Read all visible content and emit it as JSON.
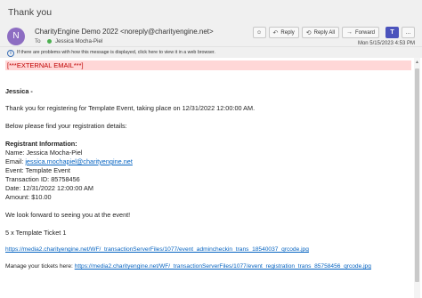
{
  "window": {
    "title": "Thank you"
  },
  "header": {
    "avatar_initial": "N",
    "sender": "CharityEngine Demo 2022 <noreply@charityengine.net>",
    "to_label": "To",
    "recipient": "Jessica Mocha-Piel",
    "datetime": "Mon 5/15/2023 4:53 PM",
    "info_message": "If there are problems with how this message is displayed, click here to view it in a web browser."
  },
  "toolbar": {
    "emoji_icon": "smiley-icon",
    "reply_label": "Reply",
    "reply_all_label": "Reply All",
    "forward_label": "Forward",
    "teams_label": "T",
    "more_label": "..."
  },
  "email": {
    "external_banner": "[***EXTERNAL EMAIL***]",
    "greeting": "Jessica -",
    "intro": "Thank you for registering for Template Event, taking place on 12/31/2022 12:00:00 AM.",
    "details_intro": "Below please find your registration details:",
    "registrant_heading": "Registrant Information:",
    "name_line": "Name: Jessica Mocha-Piel",
    "email_label": "Email: ",
    "email_value": "jessica.mochapiel@charityengine.net",
    "event_line": "Event: Template Event",
    "transaction_line": "Transaction ID: 85758456",
    "date_line": "Date: 12/31/2022 12:00:00 AM",
    "amount_line": "Amount: $10.00",
    "closing": "We look forward to seeing you at the event!",
    "ticket_line": "5 x Template Ticket 1",
    "checkin_link": "https://media2.charityengine.net/WF/_transactionServerFiles/1077/event_admincheckin_trans_18540037_qrcode.jpg",
    "manage_label": "Manage your tickets here: ",
    "manage_link": "https://media2.charityengine.net/WF/_transactionServerFiles/1077/event_registration_trans_85758456_qrcode.jpg"
  }
}
